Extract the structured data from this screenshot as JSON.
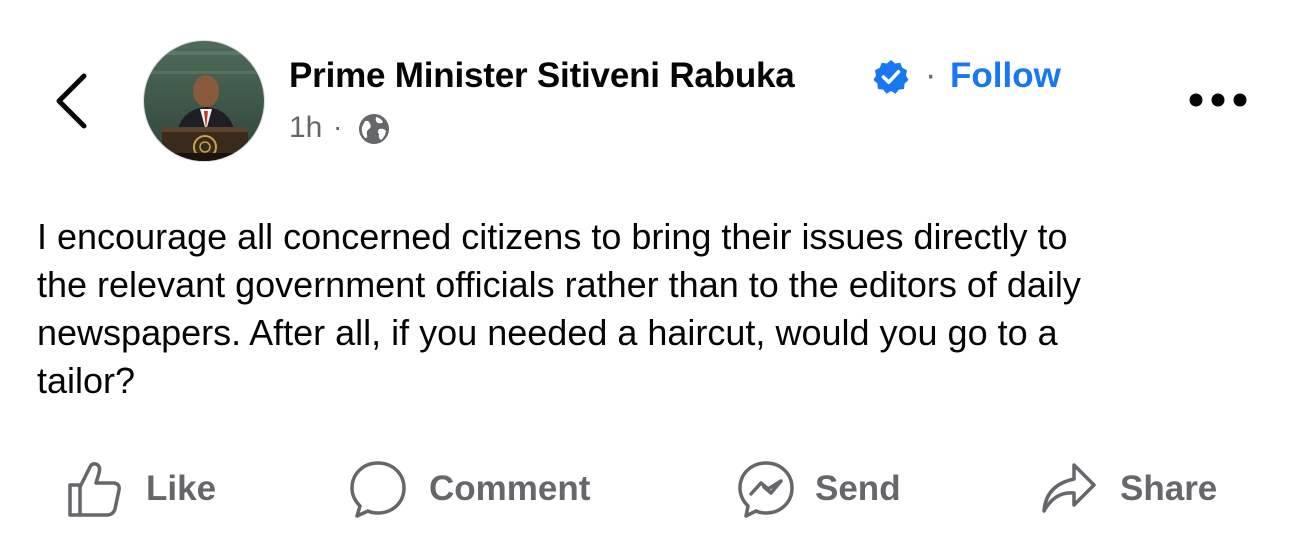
{
  "header": {
    "author_name": "Prime Minister Sitiveni Rabuka",
    "separator": "·",
    "follow_label": "Follow",
    "timestamp": "1h",
    "meta_separator": "·",
    "verified_icon": "verified-badge-icon",
    "audience_icon": "globe-icon",
    "back_icon": "chevron-left-icon",
    "more_icon": "more-horizontal-icon"
  },
  "post": {
    "text": "I encourage all concerned citizens to bring their issues directly to\nthe relevant government officials rather than to the editors of daily\nnewspapers. After all, if you needed a haircut, would you go to a\ntailor?"
  },
  "actions": [
    {
      "label": "Like",
      "icon": "thumbs-up-icon"
    },
    {
      "label": "Comment",
      "icon": "comment-bubble-icon"
    },
    {
      "label": "Send",
      "icon": "messenger-icon"
    },
    {
      "label": "Share",
      "icon": "share-arrow-icon"
    }
  ],
  "colors": {
    "accent": "#1877f2",
    "secondary_text": "#65676b",
    "primary_text": "#050505"
  }
}
